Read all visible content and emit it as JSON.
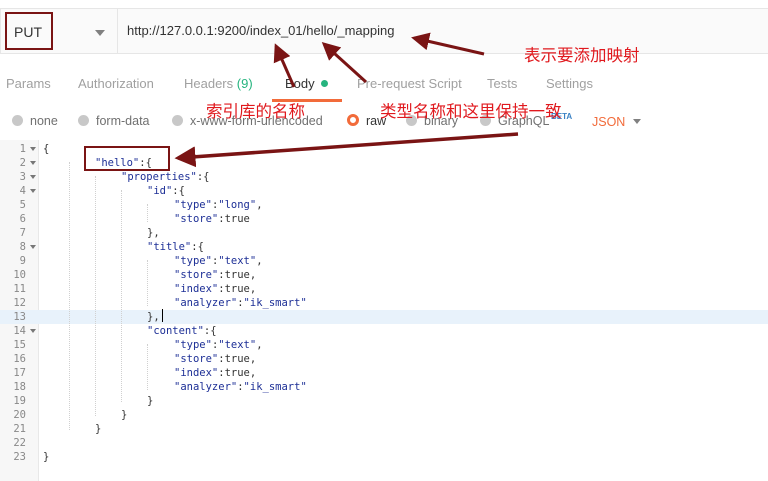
{
  "request": {
    "method": "PUT",
    "url": "http://127.0.0.1:9200/index_01/hello/_mapping"
  },
  "tabs": [
    {
      "label": "Params"
    },
    {
      "label": "Authorization"
    },
    {
      "label": "Headers",
      "count": "(9)"
    },
    {
      "label": "Body",
      "active": true
    },
    {
      "label": "Pre-request Script"
    },
    {
      "label": "Tests"
    },
    {
      "label": "Settings"
    }
  ],
  "body_types": [
    "none",
    "form-data",
    "x-www-form-urlencoded",
    "raw",
    "binary",
    "GraphQL"
  ],
  "body_type_selected": "raw",
  "graphql_badge": "BETA",
  "raw_language": "JSON",
  "editor": {
    "lines": [
      {
        "n": "1",
        "t": "{"
      },
      {
        "n": "2",
        "t": "\"hello\":{"
      },
      {
        "n": "3",
        "t": "\"properties\":{"
      },
      {
        "n": "4",
        "t": "\"id\":{"
      },
      {
        "n": "5",
        "t": "\"type\":\"long\","
      },
      {
        "n": "6",
        "t": "\"store\":true"
      },
      {
        "n": "7",
        "t": "},"
      },
      {
        "n": "8",
        "t": "\"title\":{"
      },
      {
        "n": "9",
        "t": "\"type\":\"text\","
      },
      {
        "n": "10",
        "t": "\"store\":true,"
      },
      {
        "n": "11",
        "t": "\"index\":true,"
      },
      {
        "n": "12",
        "t": "\"analyzer\":\"ik_smart\""
      },
      {
        "n": "13",
        "t": "},"
      },
      {
        "n": "14",
        "t": "\"content\":{"
      },
      {
        "n": "15",
        "t": "\"type\":\"text\","
      },
      {
        "n": "16",
        "t": "\"store\":true,"
      },
      {
        "n": "17",
        "t": "\"index\":true,"
      },
      {
        "n": "18",
        "t": "\"analyzer\":\"ik_smart\""
      },
      {
        "n": "19",
        "t": "}"
      },
      {
        "n": "20",
        "t": "}"
      },
      {
        "n": "21",
        "t": "}"
      },
      {
        "n": "22",
        "t": ""
      },
      {
        "n": "23",
        "t": "}"
      }
    ]
  },
  "annotations": {
    "mapping": "表示要添加映射",
    "index_name": "索引库的名称",
    "type_name": "类型名称和这里保持一致"
  },
  "colors": {
    "accent": "#f26b3a",
    "annotation_text": "#e0191e",
    "annotation_box": "#7a1414",
    "green_indicator": "#26b47f"
  }
}
